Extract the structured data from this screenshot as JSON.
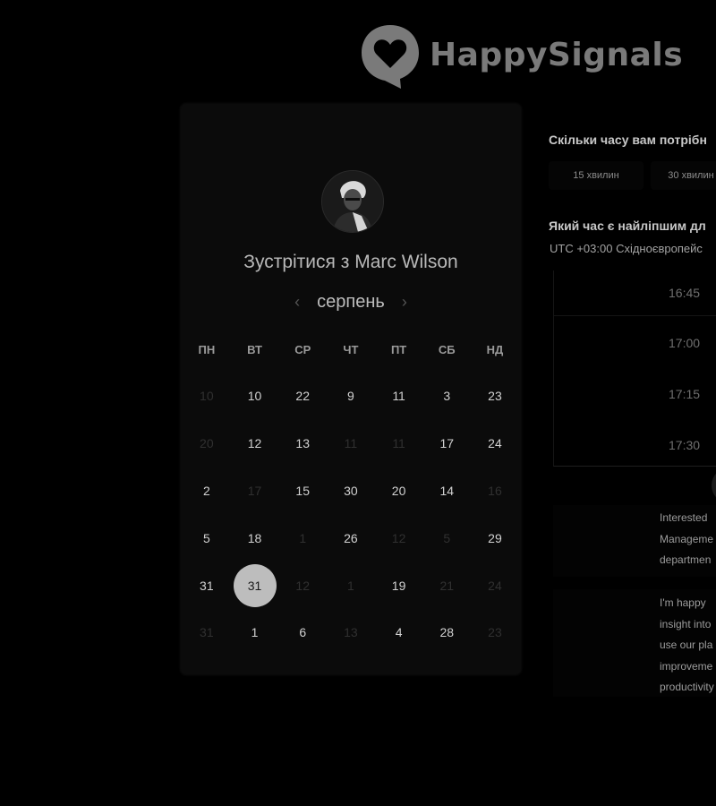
{
  "brand": {
    "name": "HappySignals",
    "logo_color": "#7a7a7a"
  },
  "card": {
    "title": "Зустрітися з Marc Wilson",
    "month": "серпень",
    "prev_icon": "chevron-left-icon",
    "next_icon": "chevron-right-icon",
    "weekdays": [
      "ПН",
      "ВТ",
      "СР",
      "ЧТ",
      "ПТ",
      "СБ",
      "НД"
    ],
    "days": [
      {
        "label": "10",
        "state": "muted"
      },
      {
        "label": "10",
        "state": "available"
      },
      {
        "label": "22",
        "state": "available"
      },
      {
        "label": "9",
        "state": "available"
      },
      {
        "label": "11",
        "state": "available"
      },
      {
        "label": "3",
        "state": "available"
      },
      {
        "label": "23",
        "state": "available"
      },
      {
        "label": "20",
        "state": "muted"
      },
      {
        "label": "12",
        "state": "available"
      },
      {
        "label": "13",
        "state": "available"
      },
      {
        "label": "11",
        "state": "muted"
      },
      {
        "label": "11",
        "state": "muted"
      },
      {
        "label": "17",
        "state": "available"
      },
      {
        "label": "24",
        "state": "available"
      },
      {
        "label": "2",
        "state": "available"
      },
      {
        "label": "17",
        "state": "muted"
      },
      {
        "label": "15",
        "state": "available"
      },
      {
        "label": "30",
        "state": "available"
      },
      {
        "label": "20",
        "state": "available"
      },
      {
        "label": "14",
        "state": "available"
      },
      {
        "label": "16",
        "state": "muted"
      },
      {
        "label": "5",
        "state": "available"
      },
      {
        "label": "18",
        "state": "available"
      },
      {
        "label": "1",
        "state": "muted"
      },
      {
        "label": "26",
        "state": "available"
      },
      {
        "label": "12",
        "state": "muted"
      },
      {
        "label": "5",
        "state": "muted"
      },
      {
        "label": "29",
        "state": "available"
      },
      {
        "label": "31",
        "state": "available"
      },
      {
        "label": "31",
        "state": "selected"
      },
      {
        "label": "12",
        "state": "muted"
      },
      {
        "label": "1",
        "state": "muted"
      },
      {
        "label": "19",
        "state": "available"
      },
      {
        "label": "21",
        "state": "muted"
      },
      {
        "label": "24",
        "state": "muted"
      },
      {
        "label": "31",
        "state": "muted"
      },
      {
        "label": "1",
        "state": "available"
      },
      {
        "label": "6",
        "state": "available"
      },
      {
        "label": "13",
        "state": "muted"
      },
      {
        "label": "4",
        "state": "available"
      },
      {
        "label": "28",
        "state": "available"
      },
      {
        "label": "23",
        "state": "muted"
      }
    ]
  },
  "panel": {
    "duration_question": "Скільки часу вам потрібн",
    "durations": [
      "15 хвилин",
      "30 хвилин"
    ],
    "time_question": "Який час є найліпшим дл",
    "timezone": "UTC +03:00 Східноєвропейс",
    "slots": [
      "16:45",
      "17:00",
      "17:15",
      "17:30"
    ],
    "message_1": [
      "Interested",
      "Manageme",
      "departmen"
    ],
    "message_2": [
      "I'm happy",
      "insight into",
      "use our pla",
      "improveme",
      "productivity"
    ]
  }
}
